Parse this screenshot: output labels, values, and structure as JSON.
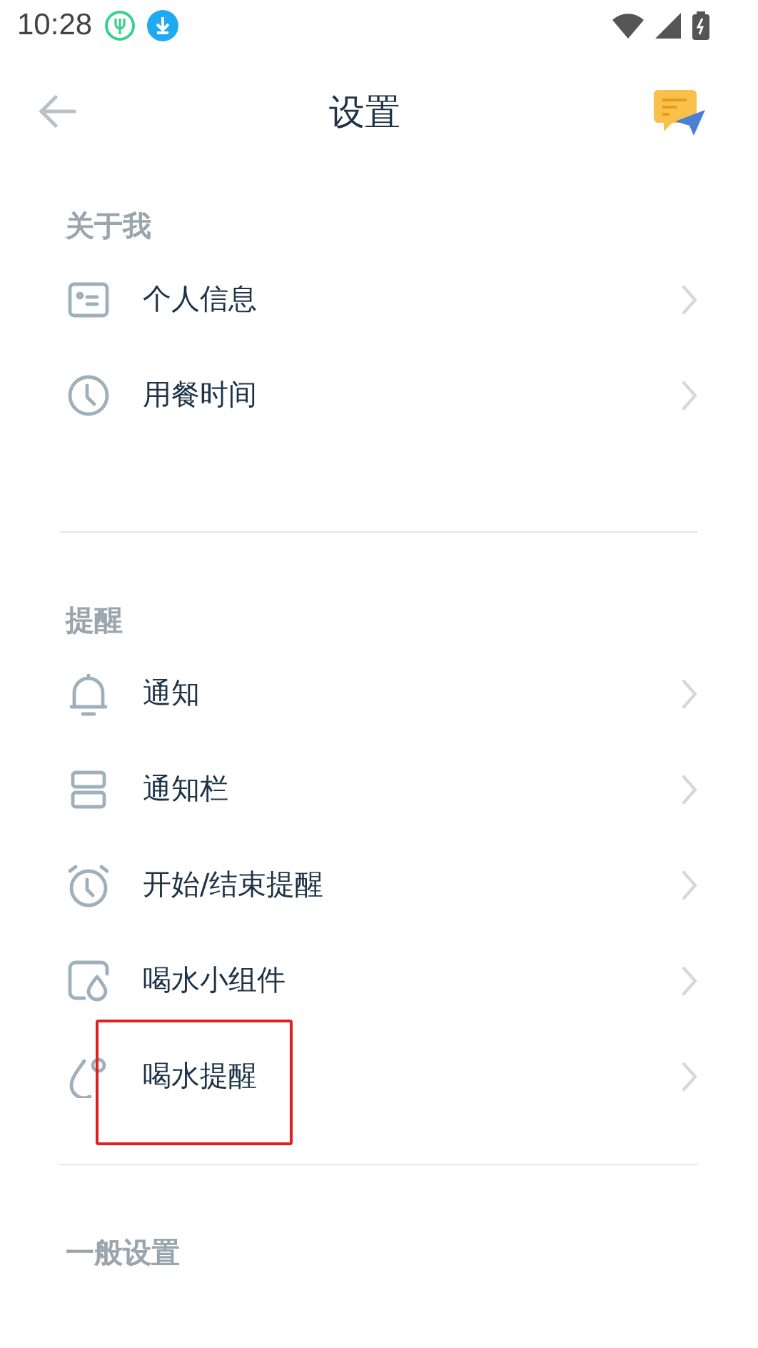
{
  "status_bar": {
    "time": "10:28"
  },
  "header": {
    "title": "设置"
  },
  "sections": [
    {
      "title": "关于我",
      "items": [
        {
          "label": "个人信息",
          "kind": "card",
          "highlighted": false
        },
        {
          "label": "用餐时间",
          "kind": "clock",
          "highlighted": false
        }
      ]
    },
    {
      "title": "提醒",
      "items": [
        {
          "label": "通知",
          "kind": "bell",
          "highlighted": false
        },
        {
          "label": "通知栏",
          "kind": "bars",
          "highlighted": false
        },
        {
          "label": "开始/结束提醒",
          "kind": "alarm",
          "highlighted": false
        },
        {
          "label": "喝水小组件",
          "kind": "widget",
          "highlighted": false
        },
        {
          "label": "喝水提醒",
          "kind": "drop",
          "highlighted": true
        }
      ]
    },
    {
      "title": "一般设置"
    }
  ]
}
